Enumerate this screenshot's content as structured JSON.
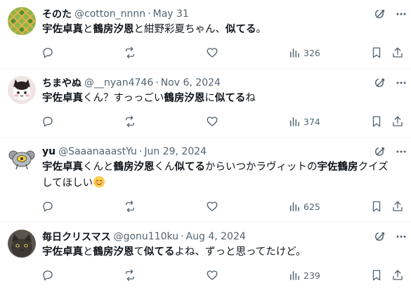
{
  "colors": {
    "text": "#0f1419",
    "secondary": "#536471",
    "divider": "#eff3f4"
  },
  "tweets": [
    {
      "name": "そのた",
      "handle": "@cotton_nnnn",
      "dot": "·",
      "date": "May 31",
      "text_parts": [
        {
          "t": "宇佐卓真",
          "b": true
        },
        {
          "t": "と",
          "b": false
        },
        {
          "t": "鶴房汐恩",
          "b": true
        },
        {
          "t": "と紺野彩夏ちゃん、",
          "b": false
        },
        {
          "t": "似てる",
          "b": true
        },
        {
          "t": "。",
          "b": false
        }
      ],
      "views": "326",
      "avatar_icon": "green-lattice-avatar"
    },
    {
      "name": "ちまやぬ",
      "handle": "@__nyan4746",
      "dot": "·",
      "date": "Nov 6, 2024",
      "text_parts": [
        {
          "t": "宇佐卓真",
          "b": true
        },
        {
          "t": "くん？すっっごい",
          "b": false
        },
        {
          "t": "鶴房汐恩",
          "b": true
        },
        {
          "t": "に",
          "b": false
        },
        {
          "t": "似てる",
          "b": true
        },
        {
          "t": "ね",
          "b": false
        }
      ],
      "views": "374",
      "avatar_icon": "cat-avatar"
    },
    {
      "name": "yu",
      "handle": "@SaaanaaastYu",
      "dot": "·",
      "date": "Jun 29, 2024",
      "text_parts": [
        {
          "t": "宇佐卓真",
          "b": true
        },
        {
          "t": "くんと",
          "b": false
        },
        {
          "t": "鶴房汐恩",
          "b": true
        },
        {
          "t": "くん",
          "b": false
        },
        {
          "t": "似てる",
          "b": true
        },
        {
          "t": "からいつかラヴィットの",
          "b": false
        },
        {
          "t": "宇佐鶴房",
          "b": true
        },
        {
          "t": "クイズ",
          "b": false
        },
        {
          "t": "してほしい",
          "b": false
        }
      ],
      "emoji": "smiling-face-emoji",
      "views": "625",
      "avatar_icon": "koala-avatar"
    },
    {
      "name": "毎日クリスマス",
      "handle": "@gonu110ku",
      "dot": "·",
      "date": "Aug 4, 2024",
      "text_parts": [
        {
          "t": "宇佐卓真",
          "b": true
        },
        {
          "t": "と",
          "b": false
        },
        {
          "t": "鶴房汐恩",
          "b": true
        },
        {
          "t": "て",
          "b": false
        },
        {
          "t": "似てる",
          "b": true
        },
        {
          "t": "よね、ずっと思ってたけど。",
          "b": false
        }
      ],
      "views": "239",
      "avatar_icon": "dark-cat-avatar"
    }
  ]
}
